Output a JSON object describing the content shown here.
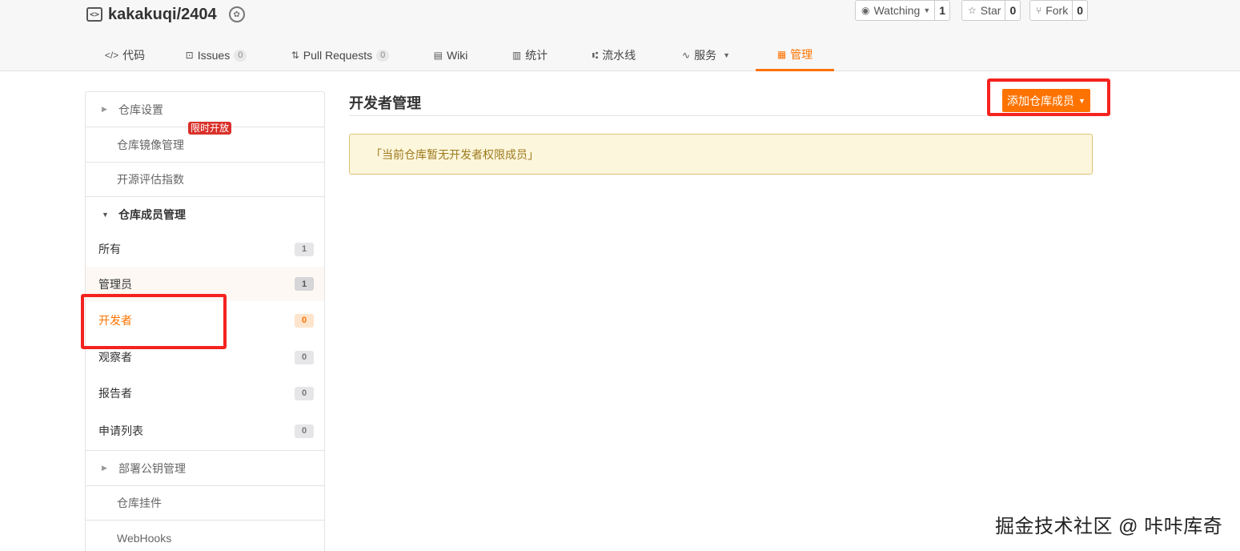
{
  "repo": {
    "name": "kakakuqi/2404"
  },
  "actions": {
    "watching": {
      "label": "Watching",
      "count": "1"
    },
    "star": {
      "label": "Star",
      "count": "0"
    },
    "fork": {
      "label": "Fork",
      "count": "0"
    }
  },
  "tabs": [
    {
      "label": "代码",
      "icon": "code-icon"
    },
    {
      "label": "Issues",
      "count": "0",
      "icon": "issues-icon"
    },
    {
      "label": "Pull Requests",
      "count": "0",
      "icon": "pull-request-icon"
    },
    {
      "label": "Wiki",
      "icon": "wiki-icon"
    },
    {
      "label": "统计",
      "icon": "stats-icon"
    },
    {
      "label": "流水线",
      "icon": "pipeline-icon"
    },
    {
      "label": "服务",
      "icon": "service-icon"
    },
    {
      "label": "管理",
      "icon": "manage-icon",
      "active": true
    }
  ],
  "sidebar": {
    "repo_settings": "仓库设置",
    "mirror": "仓库镜像管理",
    "limited_badge": "限时开放",
    "oss_index": "开源评估指数",
    "members_head": "仓库成员管理",
    "members": [
      {
        "label": "所有",
        "count": "1"
      },
      {
        "label": "管理员",
        "count": "1"
      },
      {
        "label": "开发者",
        "count": "0"
      },
      {
        "label": "观察者",
        "count": "0"
      },
      {
        "label": "报告者",
        "count": "0"
      },
      {
        "label": "申请列表",
        "count": "0"
      }
    ],
    "deploy_keys": "部署公钥管理",
    "plugins": "仓库挂件",
    "webhooks": "WebHooks"
  },
  "main": {
    "title": "开发者管理",
    "add_button": "添加仓库成员",
    "notice": "「当前仓库暂无开发者权限成员」"
  },
  "watermark": "掘金技术社区 @ 咔咔库奇",
  "colors": {
    "accent": "#fe7300",
    "annotation_red": "#f5231f"
  }
}
